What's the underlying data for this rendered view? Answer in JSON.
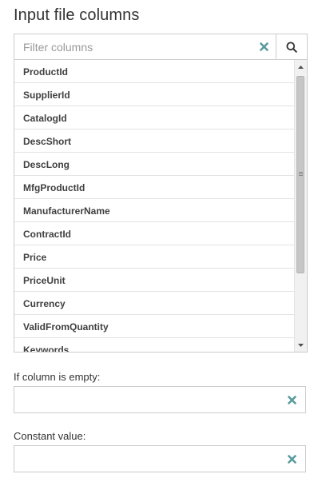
{
  "panel": {
    "title": "Input file columns"
  },
  "filter": {
    "placeholder": "Filter columns",
    "value": "",
    "clear_icon": "close-icon",
    "search_icon": "search-icon"
  },
  "columns": [
    "ProductId",
    "SupplierId",
    "CatalogId",
    "DescShort",
    "DescLong",
    "MfgProductId",
    "ManufacturerName",
    "ContractId",
    "Price",
    "PriceUnit",
    "Currency",
    "ValidFromQuantity",
    "Keywords"
  ],
  "empty_column": {
    "label": "If column is empty:",
    "value": ""
  },
  "constant_value": {
    "label": "Constant value:",
    "value": ""
  },
  "colors": {
    "clear_icon": "#5a9a9f",
    "border": "#cccccc",
    "text": "#333333"
  }
}
